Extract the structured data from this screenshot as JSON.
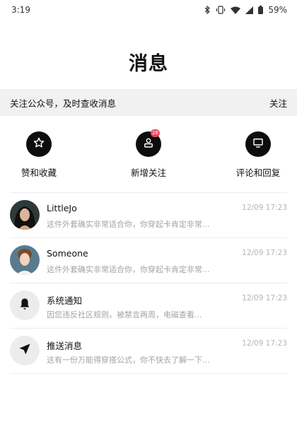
{
  "status_bar": {
    "time": "3:19",
    "battery": "59%",
    "icons": [
      "bluetooth-icon",
      "vibrate-icon",
      "wifi-icon",
      "signal-icon",
      "battery-icon"
    ]
  },
  "header": {
    "title": "消息"
  },
  "banner": {
    "text": "关注公众号，及时查收消息",
    "action": "关注"
  },
  "quick_actions": [
    {
      "label": "赞和收藏",
      "icon": "star-icon"
    },
    {
      "label": "新增关注",
      "icon": "person-icon",
      "badge": "28"
    },
    {
      "label": "评论和回复",
      "icon": "comment-icon"
    }
  ],
  "messages": [
    {
      "name": "LittleJo",
      "time": "12/09 17:23",
      "preview": "这件外套确实非常适合你，你穿起卡肯定非常...",
      "avatar": "user-photo"
    },
    {
      "name": "Someone",
      "time": "12/09 17:23",
      "preview": "这件外套确实非常适合你，你穿起卡肯定非常...",
      "avatar": "user-photo"
    },
    {
      "name": "系统通知",
      "time": "12/09 17:23",
      "preview": "因您违反社区规则，被禁言两周，电磁查看...",
      "avatar": "bell-icon"
    },
    {
      "name": "推送消息",
      "time": "12/09 17:23",
      "preview": "这有一份万能得穿搭公式，你不快去了解一下...",
      "avatar": "send-icon"
    }
  ],
  "colors": {
    "accent": "#0d0d0d",
    "badge": "#e8445a",
    "banner_bg": "#f1f1f1",
    "muted": "#a3a3a3"
  }
}
